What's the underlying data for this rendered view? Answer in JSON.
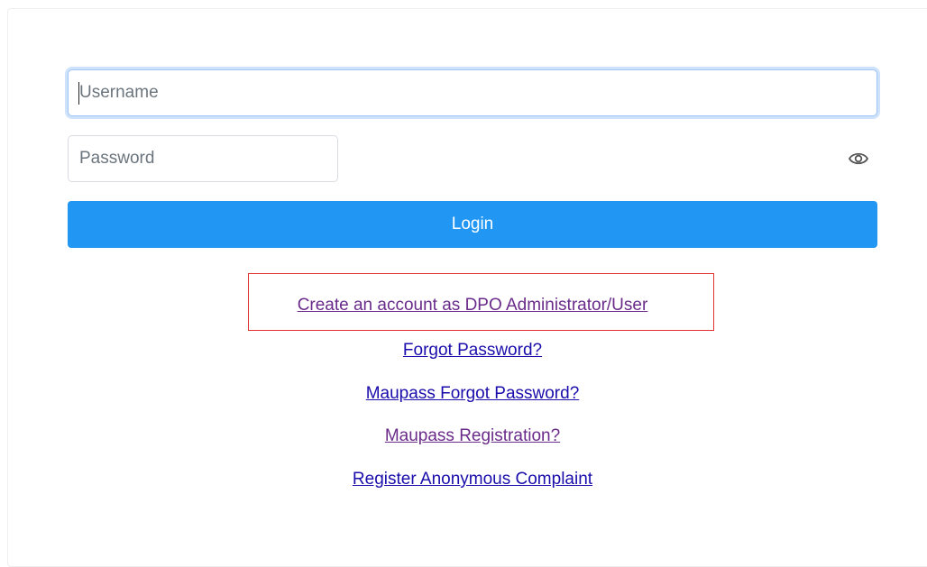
{
  "form": {
    "username_placeholder": "Username",
    "password_placeholder": "Password",
    "login_label": "Login"
  },
  "links": {
    "create_account": "Create an account as DPO Administrator/User",
    "forgot_password": "Forgot Password?",
    "maupass_forgot_password": "Maupass Forgot Password?",
    "maupass_registration": "Maupass Registration?",
    "register_anonymous": "Register Anonymous Complaint"
  },
  "icons": {
    "password_toggle": "eye-icon"
  },
  "colors": {
    "primary": "#2196f3",
    "link_visited": "#6a2b8a",
    "link": "#1a0dab",
    "highlight": "#e03030",
    "focus_border": "#9ec5f5"
  }
}
